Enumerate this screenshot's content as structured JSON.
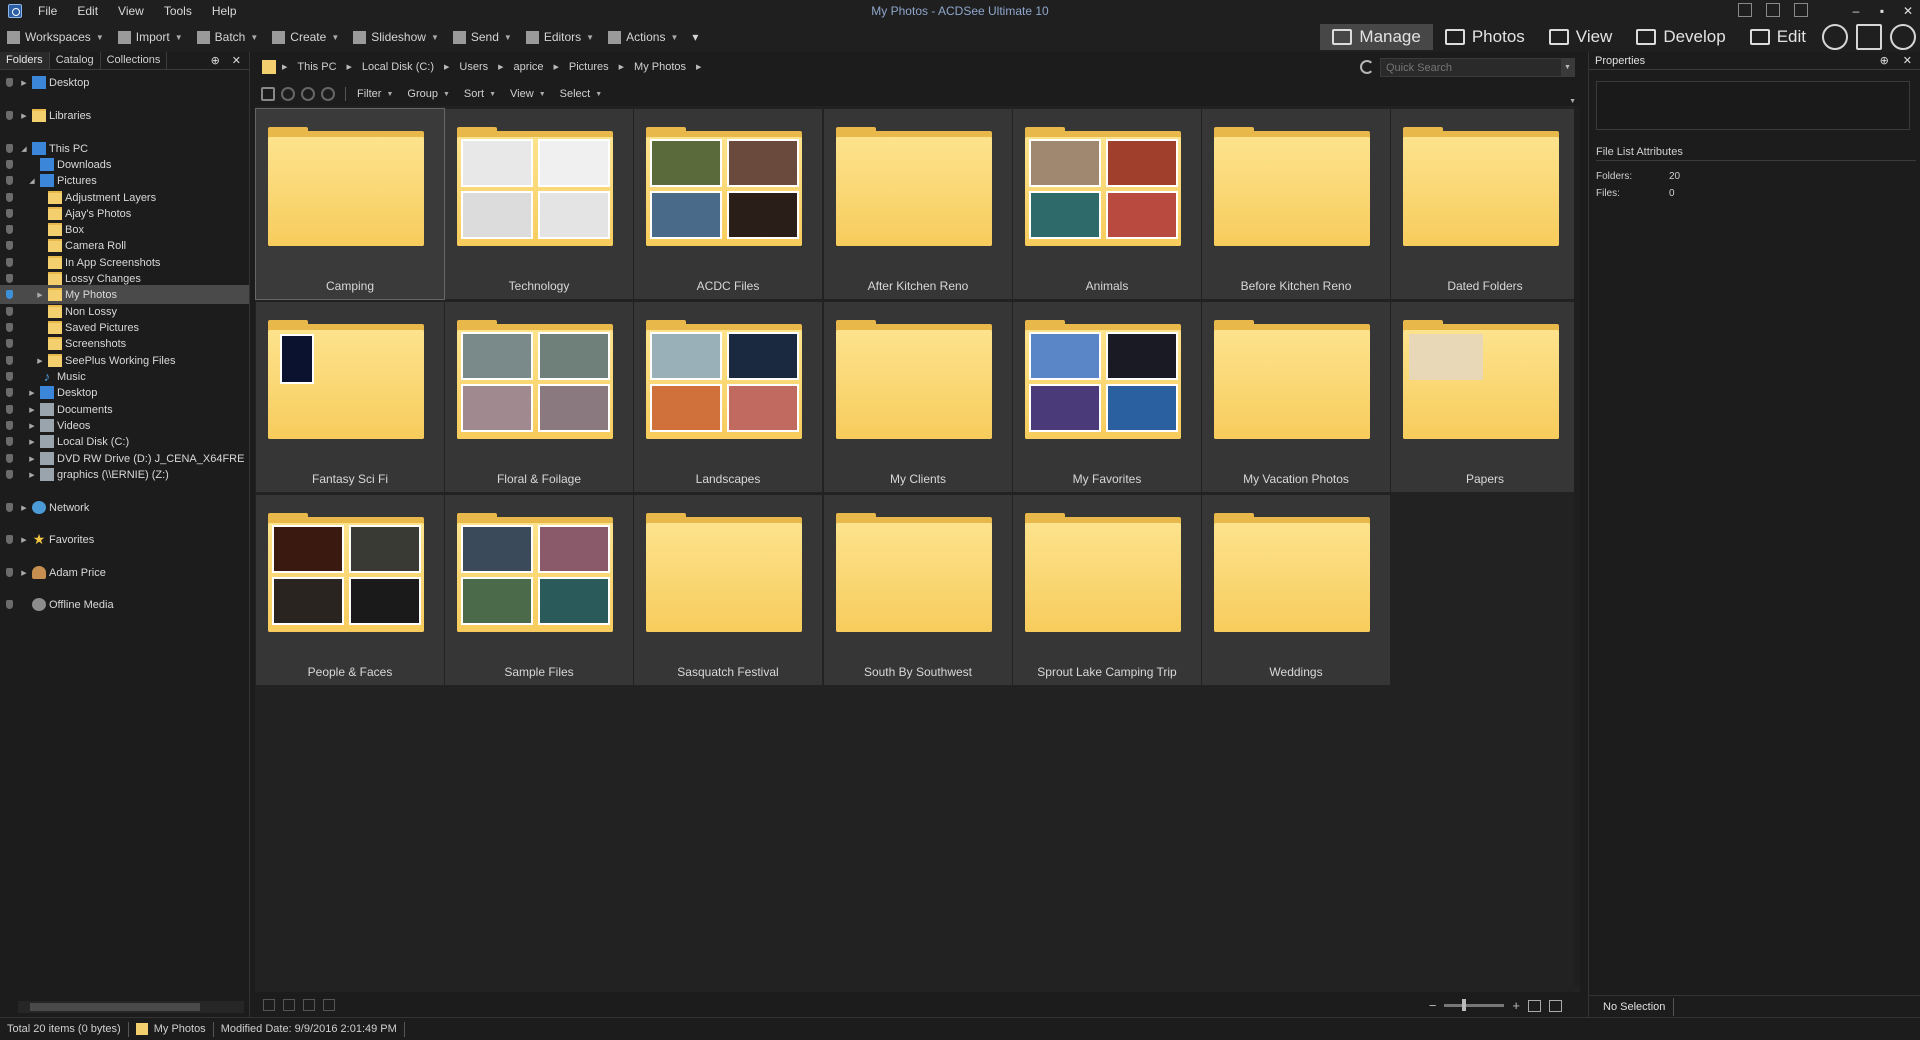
{
  "window": {
    "title": "My Photos - ACDSee Ultimate 10",
    "menu": [
      "File",
      "Edit",
      "View",
      "Tools",
      "Help"
    ],
    "controls": [
      "–",
      "▪",
      "✕"
    ]
  },
  "toolbar": {
    "items": [
      "Workspaces",
      "Import",
      "Batch",
      "Create",
      "Slideshow",
      "Send",
      "Editors",
      "Actions"
    ],
    "overflow": "▾"
  },
  "modes": {
    "tabs": [
      "Manage",
      "Photos",
      "View",
      "Develop",
      "Edit"
    ],
    "active": "Manage"
  },
  "left_panel": {
    "tabs": [
      "Folders",
      "Catalog",
      "Collections"
    ],
    "active_tab": "Folders",
    "pin": "⊕",
    "close": "✕",
    "tree": [
      {
        "label": "Desktop",
        "level": 0,
        "icon": "desktop-icon"
      },
      {
        "label": "Libraries",
        "level": 0,
        "icon": "libraries-icon"
      },
      {
        "label": "This PC",
        "level": 0,
        "icon": "computer-icon",
        "expanded": true
      },
      {
        "label": "Downloads",
        "level": 1,
        "icon": "download-icon"
      },
      {
        "label": "Pictures",
        "level": 1,
        "icon": "pictures-icon",
        "expanded": true
      },
      {
        "label": "Adjustment Layers",
        "level": 2,
        "icon": "folder-icon"
      },
      {
        "label": "Ajay's Photos",
        "level": 2,
        "icon": "folder-icon"
      },
      {
        "label": "Box",
        "level": 2,
        "icon": "folder-icon"
      },
      {
        "label": "Camera Roll",
        "level": 2,
        "icon": "folder-icon"
      },
      {
        "label": "In App Screenshots",
        "level": 2,
        "icon": "folder-icon"
      },
      {
        "label": "Lossy Changes",
        "level": 2,
        "icon": "folder-icon"
      },
      {
        "label": "My Photos",
        "level": 2,
        "icon": "folder-icon",
        "selected": true,
        "has_children": true
      },
      {
        "label": "Non Lossy",
        "level": 2,
        "icon": "folder-icon"
      },
      {
        "label": "Saved Pictures",
        "level": 2,
        "icon": "folder-icon"
      },
      {
        "label": "Screenshots",
        "level": 2,
        "icon": "folder-icon"
      },
      {
        "label": "SeePlus Working Files",
        "level": 2,
        "icon": "folder-icon",
        "has_children": true
      },
      {
        "label": "Music",
        "level": 1,
        "icon": "music-icon"
      },
      {
        "label": "Desktop",
        "level": 1,
        "icon": "desktop-icon",
        "has_children": true
      },
      {
        "label": "Documents",
        "level": 1,
        "icon": "documents-icon",
        "has_children": true
      },
      {
        "label": "Videos",
        "level": 1,
        "icon": "videos-icon",
        "has_children": true
      },
      {
        "label": "Local Disk (C:)",
        "level": 1,
        "icon": "drive-icon",
        "has_children": true
      },
      {
        "label": "DVD RW Drive (D:) J_CENA_X64FRE",
        "level": 1,
        "icon": "dvd-drive-icon",
        "has_children": true
      },
      {
        "label": "graphics (\\\\ERNIE) (Z:)",
        "level": 1,
        "icon": "network-drive-icon",
        "has_children": true
      },
      {
        "label": "Network",
        "level": 0,
        "icon": "network-icon"
      },
      {
        "label": "Favorites",
        "level": 0,
        "icon": "star-icon"
      },
      {
        "label": "Adam Price",
        "level": 0,
        "icon": "user-icon"
      },
      {
        "label": "Offline Media",
        "level": 0,
        "icon": "offline-media-icon"
      }
    ]
  },
  "address": {
    "crumbs": [
      "This PC",
      "Local Disk (C:)",
      "Users",
      "aprice",
      "Pictures",
      "My Photos"
    ],
    "search_placeholder": "Quick Search"
  },
  "nav": {
    "menus": [
      "Filter",
      "Group",
      "Sort",
      "View",
      "Select"
    ]
  },
  "folders": [
    {
      "name": "Camping",
      "thumbs": []
    },
    {
      "name": "Technology",
      "thumbs": [
        "#e8e8e8",
        "#f0f0f0",
        "#dcdcdc",
        "#e4e4e4"
      ]
    },
    {
      "name": "ACDC Files",
      "thumbs": [
        "#5b6a3a",
        "#6a4a3d",
        "#4a6a8a",
        "#2a1e18"
      ]
    },
    {
      "name": "After Kitchen Reno",
      "thumbs": []
    },
    {
      "name": "Animals",
      "thumbs": [
        "#a08870",
        "#a0402c",
        "#2f6a6a",
        "#b84a40"
      ]
    },
    {
      "name": "Before Kitchen Reno",
      "thumbs": []
    },
    {
      "name": "Dated Folders",
      "thumbs": []
    },
    {
      "name": "Fantasy Sci Fi",
      "thumbs": [
        "#0a1230"
      ]
    },
    {
      "name": "Floral & Foilage",
      "thumbs": [
        "#7a8a8a",
        "#6f7f7a",
        "#a08a90",
        "#8a7a80"
      ]
    },
    {
      "name": "Landscapes",
      "thumbs": [
        "#9ab0b8",
        "#1a2840",
        "#d0703a",
        "#c06a60"
      ]
    },
    {
      "name": "My Clients",
      "thumbs": []
    },
    {
      "name": "My Favorites",
      "thumbs": [
        "#5a86c8",
        "#1a1a24",
        "#4a3a7a",
        "#2a60a0"
      ]
    },
    {
      "name": "My Vacation Photos",
      "thumbs": []
    },
    {
      "name": "Papers",
      "thumbs": [
        "#e8d8b8"
      ]
    },
    {
      "name": "People & Faces",
      "thumbs": [
        "#3a1a10",
        "#3a3a34",
        "#2a2420",
        "#1a1a1a"
      ]
    },
    {
      "name": "Sample Files",
      "thumbs": [
        "#3a4a5a",
        "#8a5a6a",
        "#4a6a4a",
        "#2a5a5a"
      ]
    },
    {
      "name": "Sasquatch Festival",
      "thumbs": []
    },
    {
      "name": "South By Southwest",
      "thumbs": []
    },
    {
      "name": "Sprout Lake Camping Trip",
      "thumbs": []
    },
    {
      "name": "Weddings",
      "thumbs": []
    }
  ],
  "properties": {
    "title": "Properties",
    "section": "File List Attributes",
    "folders_label": "Folders:",
    "folders_value": "20",
    "files_label": "Files:",
    "files_value": "0",
    "bottom_tab": "No Selection"
  },
  "status": {
    "total": "Total 20 items  (0 bytes)",
    "folder": "My Photos",
    "modified": "Modified Date: 9/9/2016 2:01:49 PM"
  }
}
